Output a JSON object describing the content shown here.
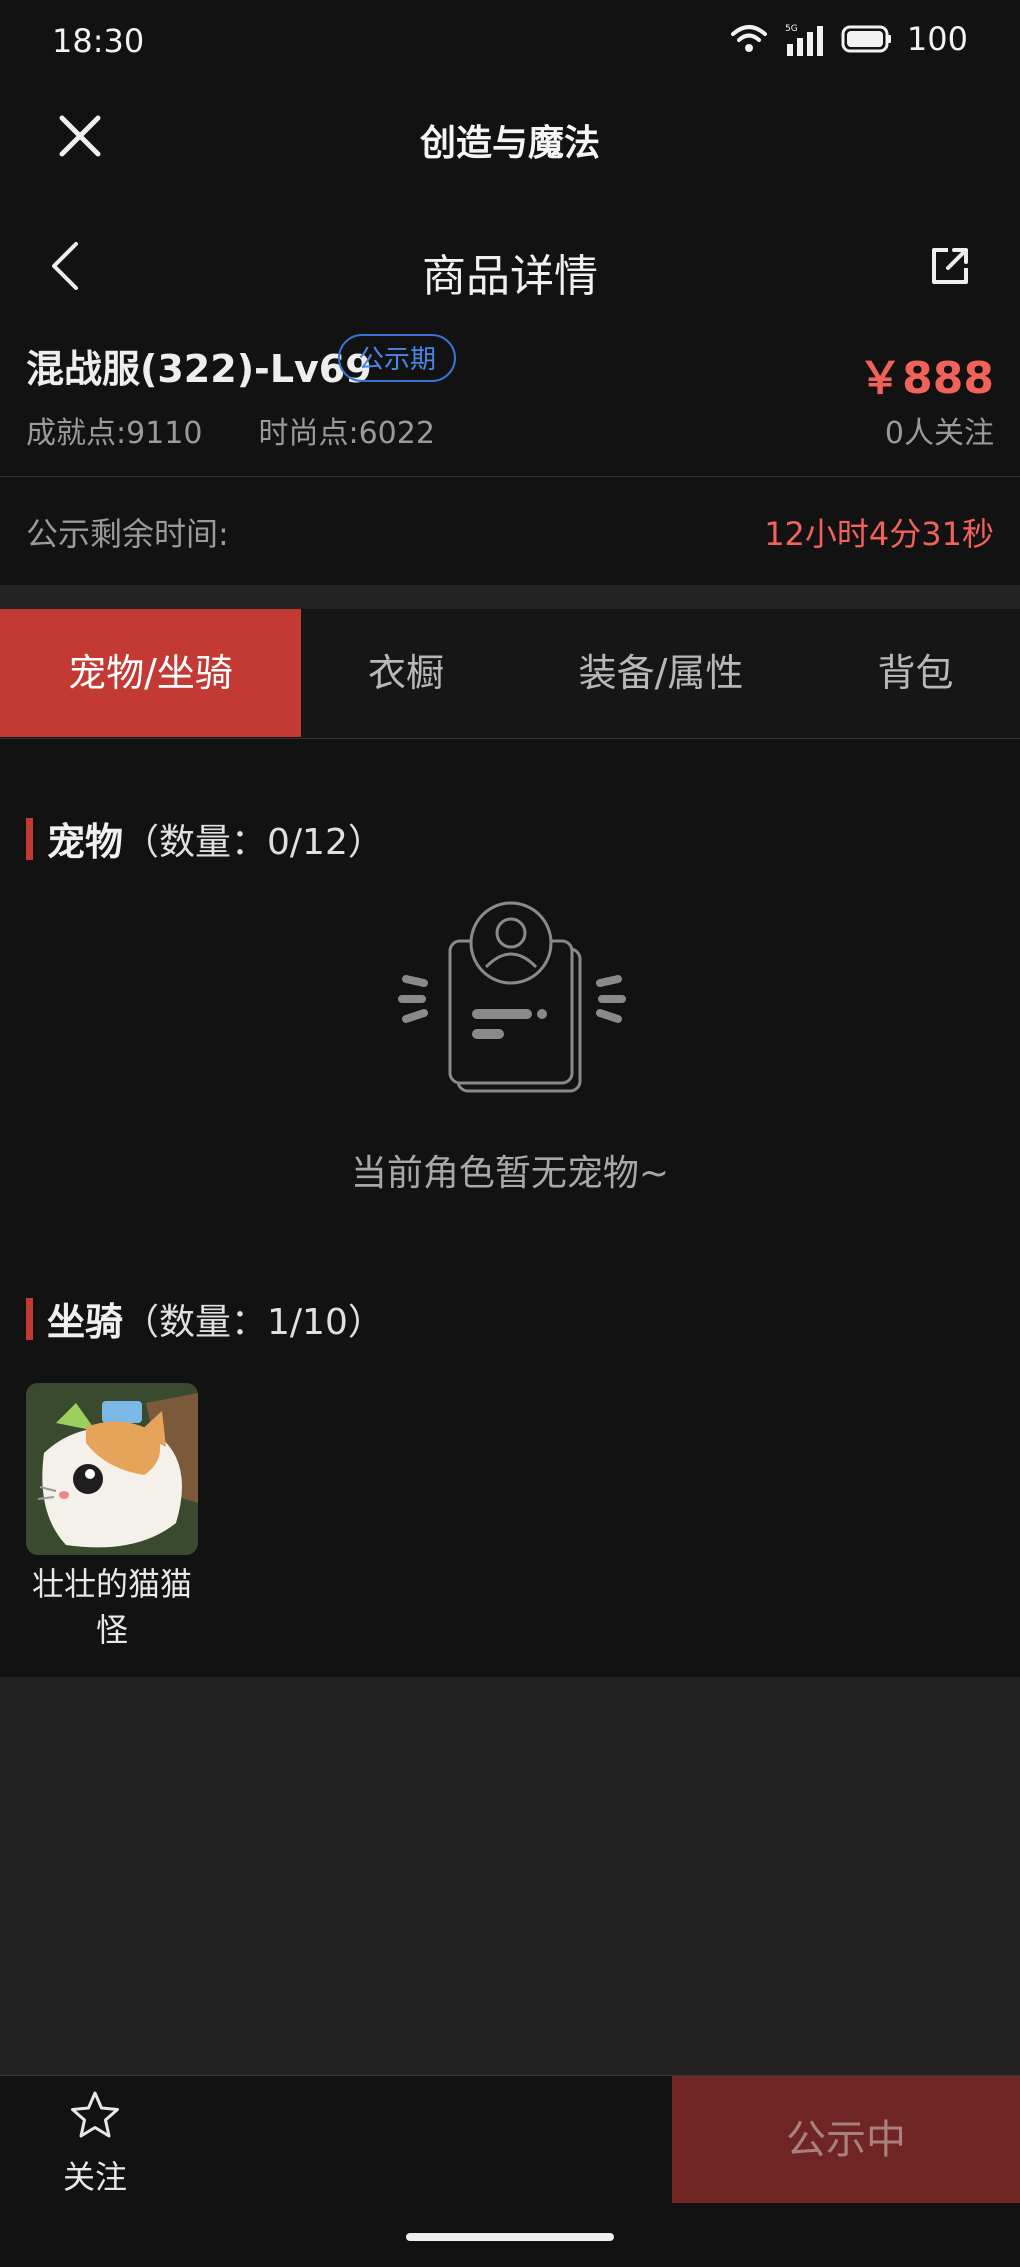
{
  "status_bar": {
    "time": "18:30",
    "battery": "100",
    "network": "5G"
  },
  "app_bar": {
    "title": "创造与魔法"
  },
  "nav_bar": {
    "title": "商品详情"
  },
  "product": {
    "name": "混战服(322)-Lv69",
    "badge": "公示期",
    "price": "￥888",
    "achievement": "成就点:9110",
    "fashion": "时尚点:6022",
    "followers": "0人关注"
  },
  "countdown": {
    "label": "公示剩余时间:",
    "value": "12小时4分31秒"
  },
  "tabs": [
    {
      "label": "宠物/坐骑",
      "active": true
    },
    {
      "label": "衣橱",
      "active": false
    },
    {
      "label": "装备/属性",
      "active": false
    },
    {
      "label": "背包",
      "active": false
    }
  ],
  "pets": {
    "title": "宠物",
    "count": "（数量：0/12）",
    "empty_text": "当前角色暂无宠物~"
  },
  "mounts": {
    "title": "坐骑",
    "count": "（数量：1/10）",
    "items": [
      {
        "name": "壮壮的猫猫怪"
      }
    ]
  },
  "bottom_bar": {
    "follow_label": "关注",
    "action_label": "公示中"
  },
  "colors": {
    "accent": "#c23a33",
    "price": "#f0625a",
    "badge": "#3a73d6",
    "background": "#121212"
  }
}
